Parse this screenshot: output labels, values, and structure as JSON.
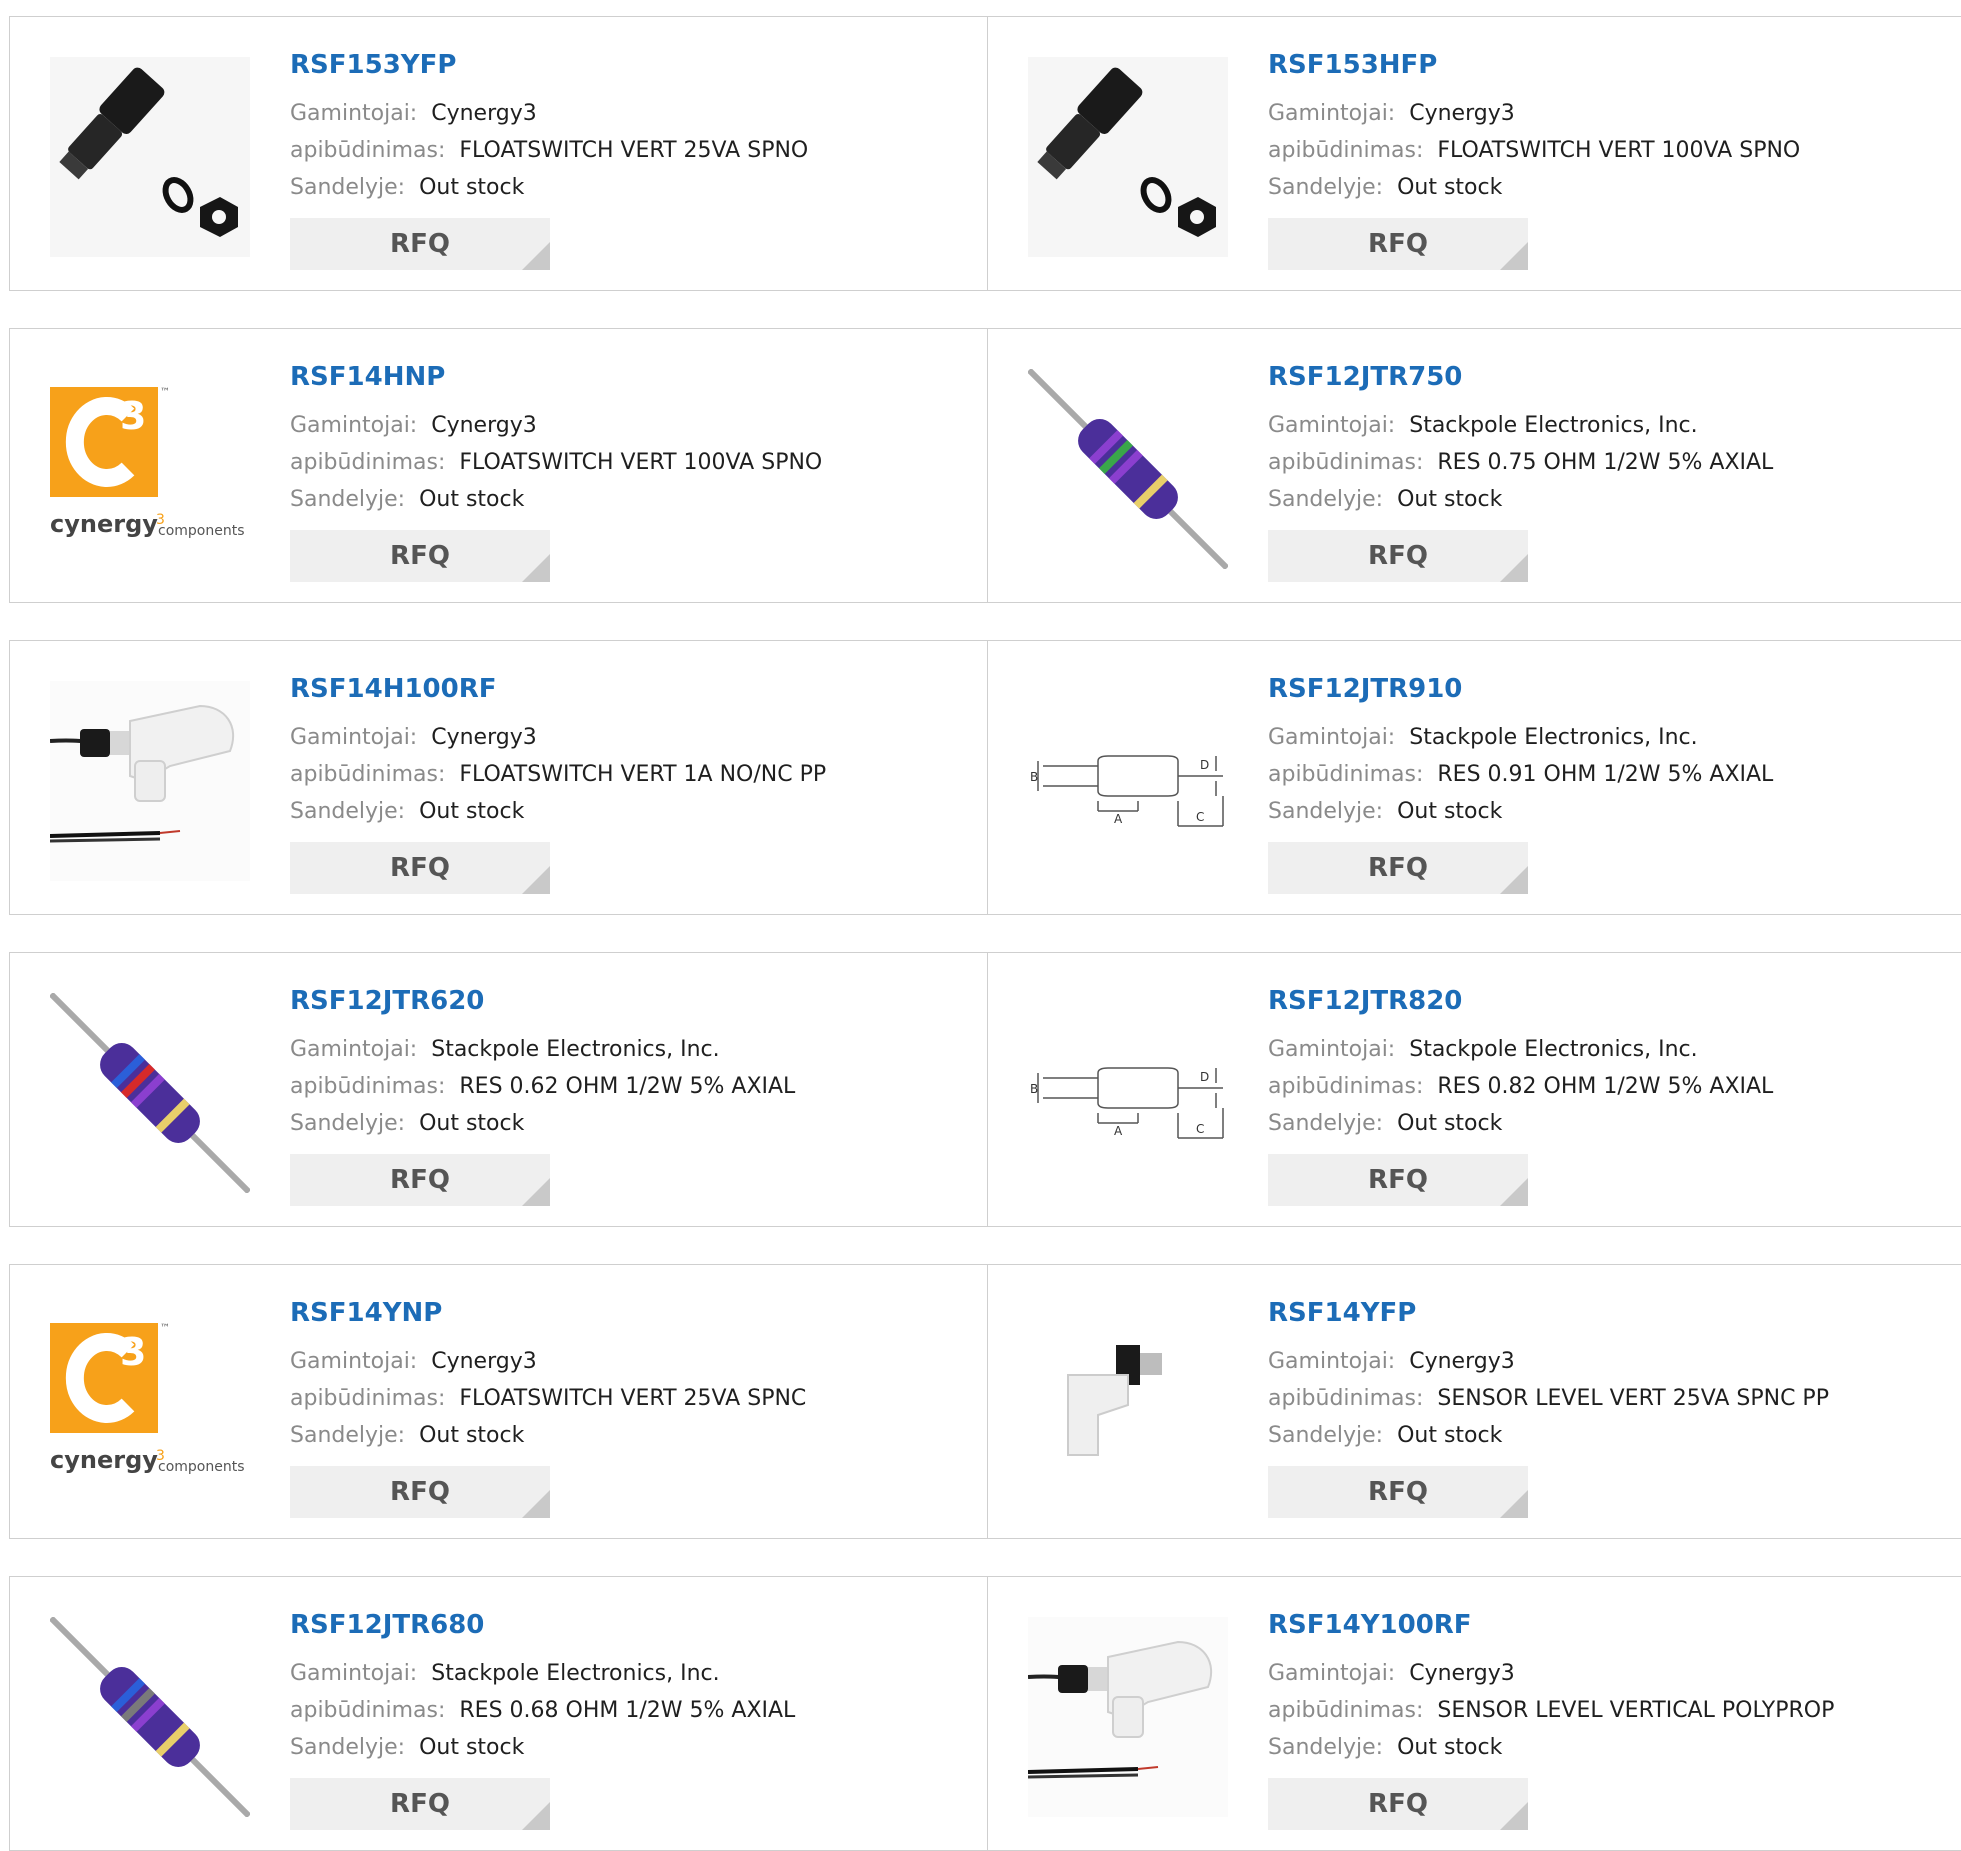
{
  "labels": {
    "manufacturer": "Gamintojai:",
    "description": "apibūdinimas:",
    "stock": "Sandelyje:",
    "rfq": "RFQ"
  },
  "products": [
    {
      "pn": "RSF153YFP",
      "mfr": "Cynergy3",
      "desc": "FLOATSWITCH VERT 25VA SPNO",
      "stock": "Out stock",
      "image": "floatswitch-black-icon"
    },
    {
      "pn": "RSF153HFP",
      "mfr": "Cynergy3",
      "desc": "FLOATSWITCH VERT 100VA SPNO",
      "stock": "Out stock",
      "image": "floatswitch-black-icon"
    },
    {
      "pn": "RSF14HNP",
      "mfr": "Cynergy3",
      "desc": "FLOATSWITCH VERT 100VA SPNO",
      "stock": "Out stock",
      "image": "cynergy3-logo"
    },
    {
      "pn": "RSF12JTR750",
      "mfr": "Stackpole Electronics, Inc.",
      "desc": "RES 0.75 OHM 1/2W 5% AXIAL",
      "stock": "Out stock",
      "image": "resistor-icon"
    },
    {
      "pn": "RSF14H100RF",
      "mfr": "Cynergy3",
      "desc": "FLOATSWITCH VERT 1A NO/NC PP",
      "stock": "Out stock",
      "image": "floatswitch-white-icon"
    },
    {
      "pn": "RSF12JTR910",
      "mfr": "Stackpole Electronics, Inc.",
      "desc": "RES 0.91 OHM 1/2W 5% AXIAL",
      "stock": "Out stock",
      "image": "resistor-diagram-icon"
    },
    {
      "pn": "RSF12JTR620",
      "mfr": "Stackpole Electronics, Inc.",
      "desc": "RES 0.62 OHM 1/2W 5% AXIAL",
      "stock": "Out stock",
      "image": "resistor-icon"
    },
    {
      "pn": "RSF12JTR820",
      "mfr": "Stackpole Electronics, Inc.",
      "desc": "RES 0.82 OHM 1/2W 5% AXIAL",
      "stock": "Out stock",
      "image": "resistor-diagram-icon"
    },
    {
      "pn": "RSF14YNP",
      "mfr": "Cynergy3",
      "desc": "FLOATSWITCH VERT 25VA SPNC",
      "stock": "Out stock",
      "image": "cynergy3-logo"
    },
    {
      "pn": "RSF14YFP",
      "mfr": "Cynergy3",
      "desc": "SENSOR LEVEL VERT 25VA SPNC PP",
      "stock": "Out stock",
      "image": "level-sensor-icon"
    },
    {
      "pn": "RSF12JTR680",
      "mfr": "Stackpole Electronics, Inc.",
      "desc": "RES 0.68 OHM 1/2W 5% AXIAL",
      "stock": "Out stock",
      "image": "resistor-icon"
    },
    {
      "pn": "RSF14Y100RF",
      "mfr": "Cynergy3",
      "desc": "SENSOR LEVEL VERTICAL POLYPROP",
      "stock": "Out stock",
      "image": "floatswitch-white-icon"
    }
  ],
  "logo": {
    "brand": "cynergy",
    "sup": "3",
    "tail": "components",
    "c": "C",
    "c_sup": "3",
    "tm": "™"
  },
  "diagram": {
    "a": "A",
    "b": "B",
    "c": "C",
    "d": "D"
  },
  "colors": {
    "link": "#1c6cb7",
    "logo_orange": "#f7a11a",
    "resistor_body": "#4b2f9a"
  }
}
